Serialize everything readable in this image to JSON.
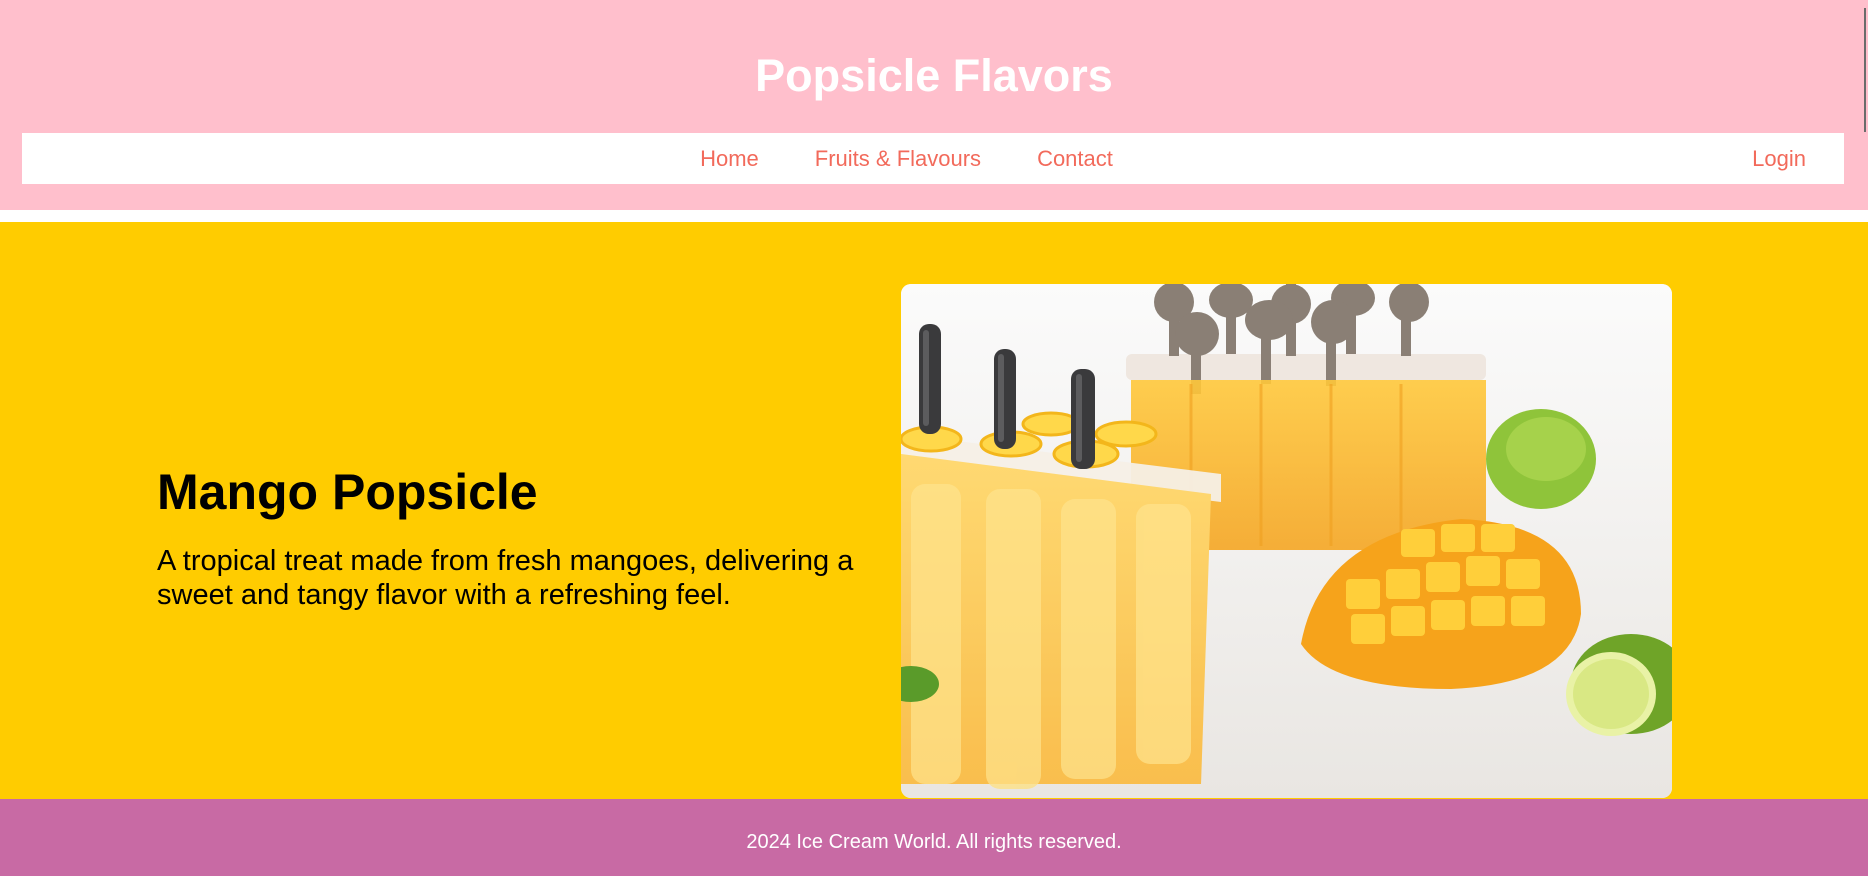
{
  "header": {
    "title": "Popsicle Flavors",
    "nav": [
      {
        "label": "Home"
      },
      {
        "label": "Fruits & Flavours"
      },
      {
        "label": "Contact"
      }
    ],
    "login_label": "Login"
  },
  "hero": {
    "title": "Mango Popsicle",
    "description": "A tropical treat made from fresh mangoes, delivering a sweet and tangy flavor with a refreshing feel.",
    "image_icon": "mango-popsicle-photo"
  },
  "footer": {
    "text": "2024 Ice Cream World. All rights reserved."
  },
  "colors": {
    "header_bg": "#ffbfcc",
    "hero_bg": "#ffcc00",
    "footer_bg": "#c86aa4",
    "link": "#f26a5b"
  }
}
